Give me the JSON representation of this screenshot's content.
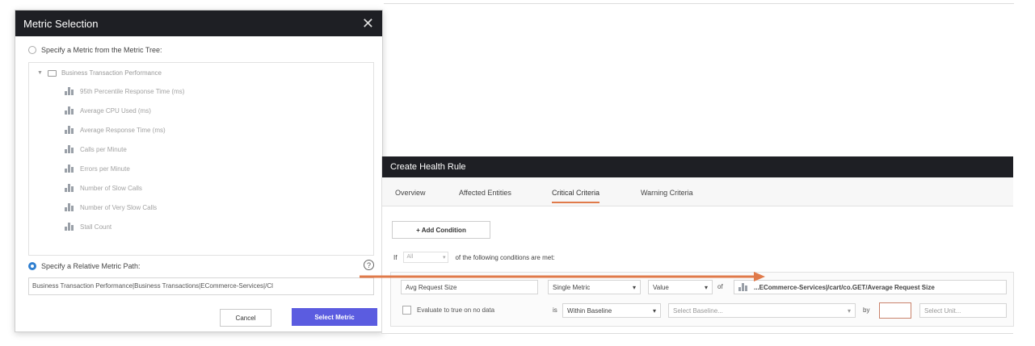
{
  "metric_dialog": {
    "title": "Metric Selection",
    "close_glyph": "✕",
    "option_tree_label": "Specify a Metric from the Metric Tree:",
    "tree_root": "Business Transaction Performance",
    "tree_items": [
      "95th Percentile Response Time (ms)",
      "Average CPU Used (ms)",
      "Average Response Time (ms)",
      "Calls per Minute",
      "Errors per Minute",
      "Number of Slow Calls",
      "Number of Very Slow Calls",
      "Stall Count"
    ],
    "option_relative_label": "Specify a Relative Metric Path:",
    "help_glyph": "?",
    "relative_path_value": "Business Transaction Performance|Business Transactions|ECommerce-Services|/Cl",
    "cancel_label": "Cancel",
    "select_label": "Select Metric"
  },
  "health_rule": {
    "title": "Create Health Rule",
    "tabs": [
      "Overview",
      "Affected Entities",
      "Critical Criteria",
      "Warning Criteria"
    ],
    "active_tab": "Critical Criteria",
    "add_condition_label": "+ Add Condition",
    "if_label": "If",
    "if_select": "All",
    "conditions_text": "of the following conditions are met:",
    "condition_name": "Avg Request Size",
    "metric_type": "Single Metric",
    "value_select": "Value",
    "of_label": "of",
    "metric_path": "...ECommerce-Services|/cart/co.GET/Average Request Size",
    "evaluate_label": "Evaluate to true on no data",
    "is_label": "is",
    "comparison": "Within Baseline",
    "baseline_placeholder": "Select Baseline...",
    "by_label": "by",
    "unit_placeholder": "Select Unit..."
  },
  "colors": {
    "header_bg": "#1e1f24",
    "primary_button": "#5b5ce0",
    "active_tab_underline": "#e07a4a",
    "arrow": "#e07a4a"
  }
}
